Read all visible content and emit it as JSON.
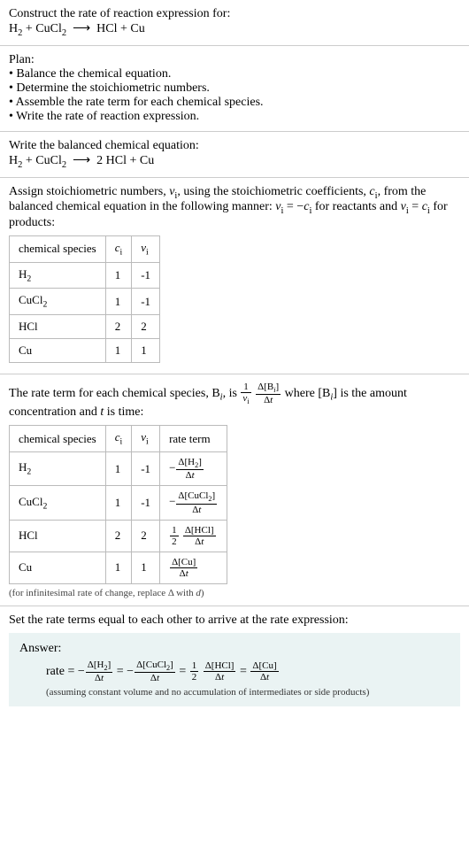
{
  "intro": {
    "prompt": "Construct the rate of reaction expression for:",
    "equation_html": "H<sub>2</sub> + CuCl<sub>2</sub> &nbsp;⟶&nbsp; HCl + Cu"
  },
  "plan": {
    "heading": "Plan:",
    "items": [
      "Balance the chemical equation.",
      "Determine the stoichiometric numbers.",
      "Assemble the rate term for each chemical species.",
      "Write the rate of reaction expression."
    ]
  },
  "balanced": {
    "heading": "Write the balanced chemical equation:",
    "equation_html": "H<sub>2</sub> + CuCl<sub>2</sub> &nbsp;⟶&nbsp; 2 HCl + Cu"
  },
  "stoich": {
    "intro_html": "Assign stoichiometric numbers, <span class='inline-math'>ν<sub class='plain'>i</sub></span>, using the stoichiometric coefficients, <span class='inline-math'>c<sub class='plain'>i</sub></span>, from the balanced chemical equation in the following manner: <span class='inline-math'>ν<sub class='plain'>i</sub></span> = −<span class='inline-math'>c<sub class='plain'>i</sub></span> for reactants and <span class='inline-math'>ν<sub class='plain'>i</sub></span> = <span class='inline-math'>c<sub class='plain'>i</sub></span> for products:",
    "headers": [
      "chemical species",
      "c_i",
      "ν_i"
    ],
    "header_html": [
      "chemical species",
      "<span class='inline-math'>c<sub class='plain'>i</sub></span>",
      "<span class='inline-math'>ν<sub class='plain'>i</sub></span>"
    ],
    "rows": [
      {
        "species_html": "H<sub>2</sub>",
        "c": "1",
        "nu": "-1"
      },
      {
        "species_html": "CuCl<sub>2</sub>",
        "c": "1",
        "nu": "-1"
      },
      {
        "species_html": "HCl",
        "c": "2",
        "nu": "2"
      },
      {
        "species_html": "Cu",
        "c": "1",
        "nu": "1"
      }
    ]
  },
  "rateterm": {
    "intro_html": "The rate term for each chemical species, B<sub><span class='inline-math'>i</span></sub>, is <span class='frac'><span class='num'>1</span><span class='den'><span class='inline-math'>ν<sub class='plain'>i</sub></span></span></span> <span class='frac'><span class='num'>Δ[B<sub><span class=\"inline-math\">i</span></sub>]</span><span class='den'>Δ<span class=\"inline-math\">t</span></span></span> where [B<sub><span class='inline-math'>i</span></sub>] is the amount concentration and <span class='inline-math'>t</span> is time:",
    "header_html": [
      "chemical species",
      "<span class='inline-math'>c<sub class='plain'>i</sub></span>",
      "<span class='inline-math'>ν<sub class='plain'>i</sub></span>",
      "rate term"
    ],
    "rows": [
      {
        "species_html": "H<sub>2</sub>",
        "c": "1",
        "nu": "-1",
        "term_html": "−<span class='frac'><span class='num'>Δ[H<sub>2</sub>]</span><span class='den'>Δ<span class=\"inline-math\">t</span></span></span>"
      },
      {
        "species_html": "CuCl<sub>2</sub>",
        "c": "1",
        "nu": "-1",
        "term_html": "−<span class='frac'><span class='num'>Δ[CuCl<sub>2</sub>]</span><span class='den'>Δ<span class=\"inline-math\">t</span></span></span>"
      },
      {
        "species_html": "HCl",
        "c": "2",
        "nu": "2",
        "term_html": "<span class='frac'><span class='num'>1</span><span class='den'>2</span></span> <span class='frac'><span class='num'>Δ[HCl]</span><span class='den'>Δ<span class=\"inline-math\">t</span></span></span>"
      },
      {
        "species_html": "Cu",
        "c": "1",
        "nu": "1",
        "term_html": "<span class='frac'><span class='num'>Δ[Cu]</span><span class='den'>Δ<span class=\"inline-math\">t</span></span></span>"
      }
    ],
    "note_html": "(for infinitesimal rate of change, replace Δ with <span class='inline-math'>d</span>)"
  },
  "final": {
    "heading": "Set the rate terms equal to each other to arrive at the rate expression:",
    "answer_label": "Answer:",
    "answer_html": "rate = −<span class='frac'><span class='num'>Δ[H<sub>2</sub>]</span><span class='den'>Δ<span class=\"inline-math\">t</span></span></span> = −<span class='frac'><span class='num'>Δ[CuCl<sub>2</sub>]</span><span class='den'>Δ<span class=\"inline-math\">t</span></span></span> = <span class='frac'><span class='num'>1</span><span class='den'>2</span></span> <span class='frac'><span class='num'>Δ[HCl]</span><span class='den'>Δ<span class=\"inline-math\">t</span></span></span> = <span class='frac'><span class='num'>Δ[Cu]</span><span class='den'>Δ<span class=\"inline-math\">t</span></span></span>",
    "answer_note": "(assuming constant volume and no accumulation of intermediates or side products)"
  }
}
